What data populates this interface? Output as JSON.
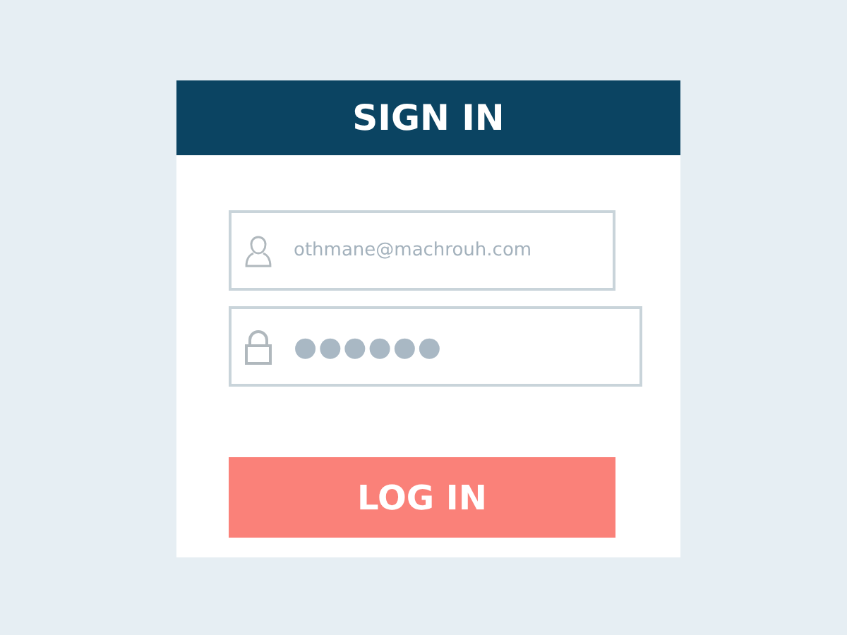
{
  "card": {
    "title": "SIGN IN"
  },
  "fields": [
    {
      "kind": "email",
      "placeholder": "othmane@machrouh.com"
    },
    {
      "kind": "password",
      "value": "●●●●●●"
    }
  ],
  "submit": {
    "label": "LOG IN"
  }
}
